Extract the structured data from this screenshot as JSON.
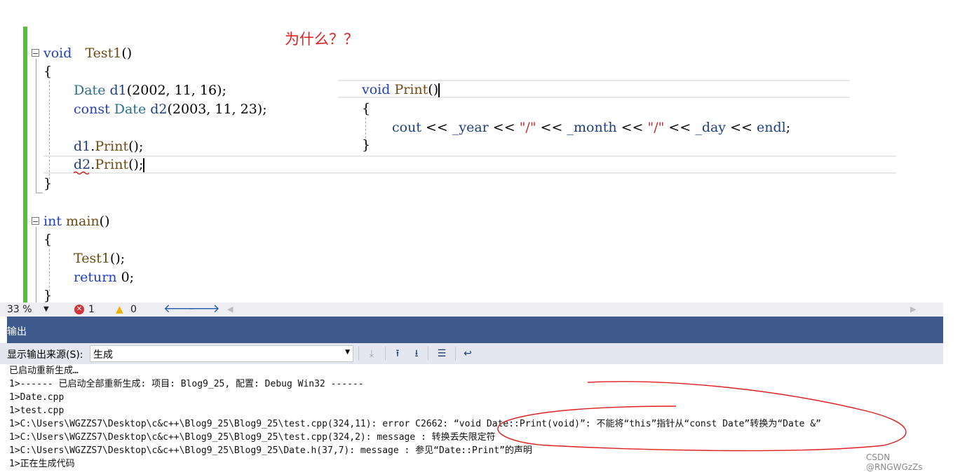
{
  "annotation": "为什么？？",
  "code_left": [
    {
      "id": "l1",
      "tokens": [
        [
          "kw",
          "void"
        ],
        [
          "",
          "　"
        ],
        [
          "fn",
          "Test1"
        ],
        [
          "",
          "()"
        ]
      ]
    },
    {
      "id": "l2",
      "tokens": [
        [
          "",
          "{"
        ]
      ]
    },
    {
      "id": "l3",
      "tokens": [
        [
          "ty",
          "Date"
        ],
        [
          "",
          " "
        ],
        [
          "var",
          "d1"
        ],
        [
          "",
          "(2002, 11, 16);"
        ]
      ]
    },
    {
      "id": "l4",
      "tokens": [
        [
          "kw",
          "const"
        ],
        [
          "",
          " "
        ],
        [
          "ty",
          "Date"
        ],
        [
          "",
          " "
        ],
        [
          "var",
          "d2"
        ],
        [
          "",
          "(2003, 11, 23);"
        ]
      ]
    },
    {
      "id": "l5",
      "tokens": [
        [
          "var",
          "d1"
        ],
        [
          "",
          "."
        ],
        [
          "fn",
          "Print"
        ],
        [
          "",
          "();"
        ]
      ]
    },
    {
      "id": "l6",
      "tokens": [
        [
          "var",
          "d2"
        ],
        [
          "",
          "."
        ],
        [
          "fn",
          "Print"
        ],
        [
          "",
          "();"
        ]
      ]
    },
    {
      "id": "l7",
      "tokens": [
        [
          "",
          "}"
        ]
      ]
    },
    {
      "id": "l8",
      "tokens": [
        [
          "kw",
          "int"
        ],
        [
          "",
          " "
        ],
        [
          "fn",
          "main"
        ],
        [
          "",
          "()"
        ]
      ]
    },
    {
      "id": "l9",
      "tokens": [
        [
          "",
          "{"
        ]
      ]
    },
    {
      "id": "l10",
      "tokens": [
        [
          "fn",
          "Test1"
        ],
        [
          "",
          "();"
        ]
      ]
    },
    {
      "id": "l11",
      "tokens": [
        [
          "kw",
          "return"
        ],
        [
          "",
          " 0;"
        ]
      ]
    },
    {
      "id": "l12",
      "tokens": [
        [
          "",
          "}"
        ]
      ]
    }
  ],
  "code_right": [
    {
      "id": "r1",
      "tokens": [
        [
          "kw",
          "void"
        ],
        [
          "",
          " "
        ],
        [
          "fn",
          "Print"
        ],
        [
          "",
          "()"
        ]
      ]
    },
    {
      "id": "r2",
      "tokens": [
        [
          "",
          "{"
        ]
      ]
    },
    {
      "id": "r3",
      "tokens": [
        [
          "var",
          "cout"
        ],
        [
          "",
          " << "
        ],
        [
          "var",
          "_year"
        ],
        [
          "",
          " << "
        ],
        [
          "str",
          "\"/\""
        ],
        [
          "",
          " << "
        ],
        [
          "var",
          "_month"
        ],
        [
          "",
          " << "
        ],
        [
          "str",
          "\"/\""
        ],
        [
          "",
          " << "
        ],
        [
          "var",
          "_day"
        ],
        [
          "",
          " << "
        ],
        [
          "var",
          "endl"
        ],
        [
          "",
          ";"
        ]
      ]
    },
    {
      "id": "r4",
      "tokens": [
        [
          "",
          "}"
        ]
      ]
    }
  ],
  "statusbar": {
    "zoom": "33 %",
    "errors": "1",
    "warnings": "0"
  },
  "output": {
    "title": "输出",
    "source_label": "显示输出来源(S):",
    "source_value": "生成",
    "lines": [
      "已启动重新生成…",
      "1>------ 已启动全部重新生成: 项目: Blog9_25, 配置: Debug Win32 ------",
      "1>Date.cpp",
      "1>test.cpp",
      "1>C:\\Users\\WGZZS7\\Desktop\\c&c++\\Blog9_25\\Blog9_25\\test.cpp(324,11): error C2662: “void Date::Print(void)”: 不能将“this”指针从“const Date”转换为“Date &”",
      "1>C:\\Users\\WGZZS7\\Desktop\\c&c++\\Blog9_25\\Blog9_25\\test.cpp(324,2): message : 转换丢失限定符",
      "1>C:\\Users\\WGZZS7\\Desktop\\c&c++\\Blog9_25\\Blog9_25\\Date.h(37,7): message : 参见“Date::Print”的声明",
      "1>正在生成代码"
    ]
  },
  "watermark": "CSDN @RNGWGzZs",
  "colors": {
    "accent": "#3e5a8c",
    "error": "#d13438",
    "warning": "#e8b400",
    "change_bar": "#57c13e",
    "annotation": "#e02020"
  }
}
